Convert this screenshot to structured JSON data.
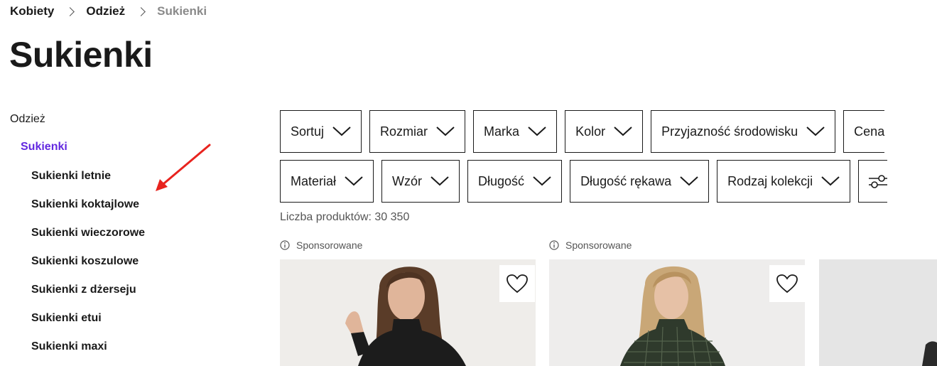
{
  "breadcrumb": {
    "items": [
      "Kobiety",
      "Odzież",
      "Sukienki"
    ]
  },
  "page_title": "Sukienki",
  "sidebar": {
    "parent": "Odzież",
    "active": "Sukienki",
    "items": [
      "Sukienki letnie",
      "Sukienki koktajlowe",
      "Sukienki wieczorowe",
      "Sukienki koszulowe",
      "Sukienki z dżerseju",
      "Sukienki etui",
      "Sukienki maxi"
    ]
  },
  "filters": {
    "row1": [
      "Sortuj",
      "Rozmiar",
      "Marka",
      "Kolor",
      "Przyjazność środowisku",
      "Cena"
    ],
    "row2": [
      "Materiał",
      "Wzór",
      "Długość",
      "Długość rękawa",
      "Rodzaj kolekcji"
    ]
  },
  "product_count": "Liczba produktów: 30 350",
  "products": [
    {
      "sponsored_label": "Sponsorowane"
    },
    {
      "sponsored_label": "Sponsorowane"
    }
  ],
  "colors": {
    "accent": "#6328e0",
    "arrow": "#e8231e"
  }
}
